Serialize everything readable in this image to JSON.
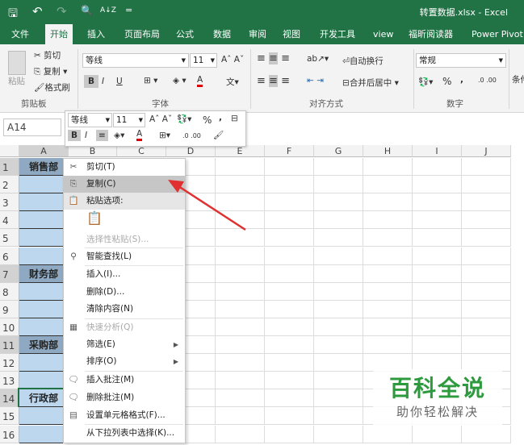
{
  "title": "转置数据.xlsx - Excel",
  "qat": {
    "save": "🖫",
    "undo": "↶",
    "redo": "↷",
    "preview": "🔍",
    "sort": "A↓Z",
    "more": "="
  },
  "tabs": [
    "文件",
    "开始",
    "插入",
    "页面布局",
    "公式",
    "数据",
    "审阅",
    "视图",
    "开发工具",
    "view",
    "福昕阅读器",
    "Power Pivot"
  ],
  "ribbon": {
    "paste": "粘贴",
    "cut": "剪切",
    "copy": "复制",
    "format_painter": "格式刷",
    "clipboard_group": "剪贴板",
    "font_name": "等线",
    "font_size": "11",
    "font_group": "字体",
    "bold": "B",
    "italic": "I",
    "underline": "U",
    "wrap_text": "自动换行",
    "merge_center": "合并后居中",
    "align_group": "对齐方式",
    "number_format": "常规",
    "percent": "%",
    "comma": ",",
    "number_group": "数字",
    "conditional": "条件"
  },
  "name_box": "A14",
  "columns": [
    "A",
    "B",
    "C",
    "D",
    "E",
    "F",
    "G",
    "H",
    "I",
    "J"
  ],
  "rows": [
    "1",
    "2",
    "3",
    "4",
    "5",
    "6",
    "7",
    "8",
    "9",
    "10",
    "11",
    "12",
    "13",
    "14",
    "15",
    "16"
  ],
  "cells": {
    "1": "销售部",
    "7": "财务部",
    "11": "采购部",
    "14": "行政部"
  },
  "mini_toolbar": {
    "font_name": "等线",
    "font_size": "11",
    "percent": "%",
    "comma": ",",
    "bold": "B",
    "italic": "I"
  },
  "context_menu": [
    {
      "label": "剪切(T)",
      "icon": "✂",
      "disabled": false
    },
    {
      "label": "复制(C)",
      "icon": "⎘",
      "disabled": false,
      "highlight": true
    },
    {
      "label": "粘贴选项:",
      "icon": "📋",
      "disabled": false,
      "header": true
    },
    {
      "label": "",
      "icon": "📋",
      "disabled": true
    },
    {
      "label": "选择性粘贴(S)...",
      "icon": "",
      "disabled": true
    },
    {
      "label": "智能查找(L)",
      "icon": "⚲",
      "disabled": false
    },
    {
      "label": "插入(I)...",
      "icon": "",
      "disabled": false
    },
    {
      "label": "删除(D)...",
      "icon": "",
      "disabled": false
    },
    {
      "label": "清除内容(N)",
      "icon": "",
      "disabled": false
    },
    {
      "label": "快速分析(Q)",
      "icon": "▦",
      "disabled": true
    },
    {
      "label": "筛选(E)",
      "icon": "",
      "disabled": false,
      "sub": true
    },
    {
      "label": "排序(O)",
      "icon": "",
      "disabled": false,
      "sub": true
    },
    {
      "label": "插入批注(M)",
      "icon": "🗨",
      "disabled": false
    },
    {
      "label": "删除批注(M)",
      "icon": "🗨",
      "disabled": false
    },
    {
      "label": "设置单元格格式(F)...",
      "icon": "▤",
      "disabled": false
    },
    {
      "label": "从下拉列表中选择(K)...",
      "icon": "",
      "disabled": false
    }
  ],
  "watermark": {
    "title": "百科全说",
    "subtitle": "助你轻松解决"
  },
  "colors": {
    "excel_green": "#217346",
    "selection": "#bdd7ee",
    "arrow": "#e03030",
    "watermark": "#2e9a3e"
  }
}
